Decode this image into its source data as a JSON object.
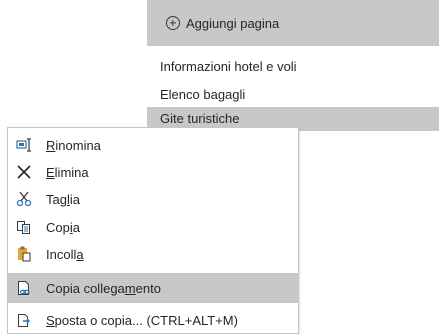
{
  "pages_panel": {
    "add_page_label": "Aggiungi pagina",
    "items": [
      {
        "label": "Informazioni hotel e voli"
      },
      {
        "label": "Elenco bagagli"
      },
      {
        "label": "Gite turistiche"
      }
    ],
    "selected_index": 2
  },
  "context_menu": {
    "items": [
      {
        "pre": "",
        "key": "R",
        "post": "inomina",
        "icon": "rename-icon"
      },
      {
        "pre": "",
        "key": "E",
        "post": "limina",
        "icon": "delete-x-icon"
      },
      {
        "pre": "Tag",
        "key": "l",
        "post": "ia",
        "icon": "scissors-icon"
      },
      {
        "pre": "Cop",
        "key": "i",
        "post": "a",
        "icon": "copy-icon"
      },
      {
        "pre": "Incoll",
        "key": "a",
        "post": "",
        "icon": "paste-icon"
      },
      {
        "pre": "Copia collega",
        "key": "m",
        "post": "ento",
        "icon": "copy-link-icon"
      },
      {
        "pre": "",
        "key": "S",
        "post": "posta o copia... (CTRL+ALT+M)",
        "icon": "move-copy-icon"
      }
    ],
    "highlighted_index": 5
  },
  "colors": {
    "selection_bg": "#c8c8c8",
    "menu_border": "#c6c6c6",
    "icon_blue": "#2e75b6",
    "icon_orange": "#e6a23c"
  }
}
